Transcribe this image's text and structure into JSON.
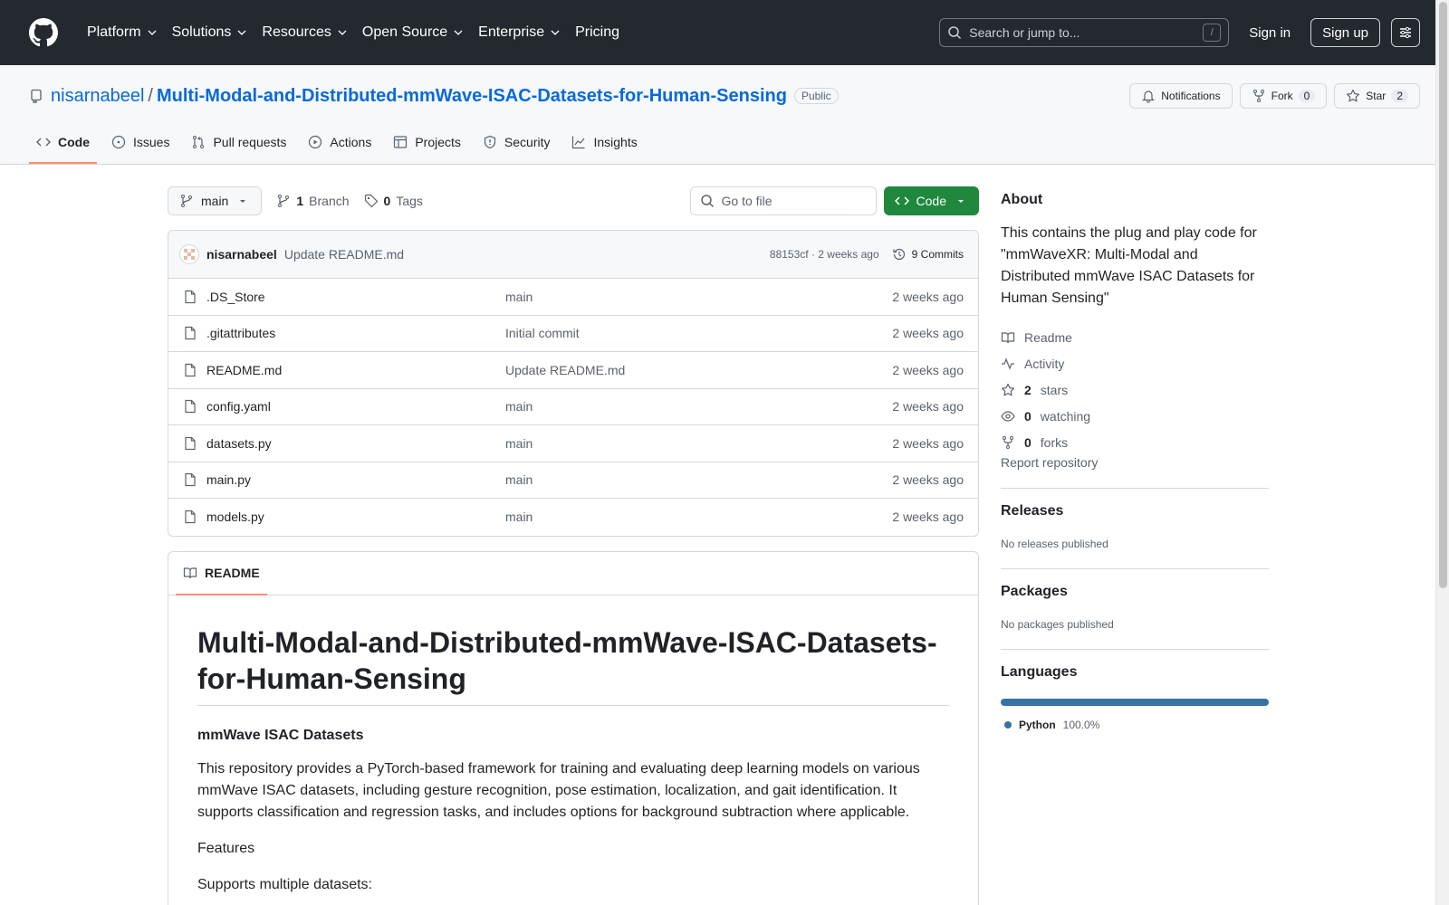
{
  "header": {
    "nav": [
      {
        "label": "Platform",
        "dropdown": true
      },
      {
        "label": "Solutions",
        "dropdown": true
      },
      {
        "label": "Resources",
        "dropdown": true
      },
      {
        "label": "Open Source",
        "dropdown": true
      },
      {
        "label": "Enterprise",
        "dropdown": true
      },
      {
        "label": "Pricing",
        "dropdown": false
      }
    ],
    "search_placeholder": "Search or jump to...",
    "search_shortcut": "/",
    "sign_in": "Sign in",
    "sign_up": "Sign up"
  },
  "repo": {
    "owner": "nisarnabeel",
    "separator": "/",
    "name": "Multi-Modal-and-Distributed-mmWave-ISAC-Datasets-for-Human-Sensing",
    "visibility": "Public",
    "notifications_label": "Notifications",
    "fork_label": "Fork",
    "fork_count": "0",
    "star_label": "Star",
    "star_count": "2"
  },
  "tabs": [
    {
      "label": "Code",
      "icon": "code-icon",
      "active": true
    },
    {
      "label": "Issues",
      "icon": "issue-icon",
      "active": false
    },
    {
      "label": "Pull requests",
      "icon": "pull-request-icon",
      "active": false
    },
    {
      "label": "Actions",
      "icon": "play-icon",
      "active": false
    },
    {
      "label": "Projects",
      "icon": "table-icon",
      "active": false
    },
    {
      "label": "Security",
      "icon": "shield-icon",
      "active": false
    },
    {
      "label": "Insights",
      "icon": "graph-icon",
      "active": false
    }
  ],
  "toolbar": {
    "branch": "main",
    "branch_count": "1",
    "branch_label": "Branch",
    "tag_count": "0",
    "tag_label": "Tags",
    "goto_placeholder": "Go to file",
    "code_button": "Code"
  },
  "commit": {
    "author": "nisarnabeel",
    "message": "Update README.md",
    "hash_time": "88153cf · 2 weeks ago",
    "commits_label": "9 Commits"
  },
  "files": [
    {
      "name": ".DS_Store",
      "message": "main",
      "date": "2 weeks ago"
    },
    {
      "name": ".gitattributes",
      "message": "Initial commit",
      "date": "2 weeks ago"
    },
    {
      "name": "README.md",
      "message": "Update README.md",
      "date": "2 weeks ago"
    },
    {
      "name": "config.yaml",
      "message": "main",
      "date": "2 weeks ago"
    },
    {
      "name": "datasets.py",
      "message": "main",
      "date": "2 weeks ago"
    },
    {
      "name": "main.py",
      "message": "main",
      "date": "2 weeks ago"
    },
    {
      "name": "models.py",
      "message": "main",
      "date": "2 weeks ago"
    }
  ],
  "readme": {
    "tab_label": "README",
    "title": "Multi-Modal-and-Distributed-mmWave-ISAC-Datasets-for-Human-Sensing",
    "subtitle": "mmWave ISAC Datasets",
    "intro": "This repository provides a PyTorch-based framework for training and evaluating deep learning models on various mmWave ISAC datasets, including gesture recognition, pose estimation, localization, and gait identification. It supports classification and regression tasks, and includes options for background subtraction where applicable.",
    "features": "Features",
    "supports": "Supports multiple datasets:"
  },
  "sidebar": {
    "about_title": "About",
    "about_desc": "This contains the plug and play code for \"mmWaveXR: Multi-Modal and Distributed mmWave ISAC Datasets for Human Sensing\"",
    "readme_link": "Readme",
    "activity_link": "Activity",
    "stars_count": "2",
    "stars_label": "stars",
    "watching_count": "0",
    "watching_label": "watching",
    "forks_count": "0",
    "forks_label": "forks",
    "report": "Report repository",
    "releases_title": "Releases",
    "releases_empty": "No releases published",
    "packages_title": "Packages",
    "packages_empty": "No packages published",
    "languages_title": "Languages",
    "language_name": "Python",
    "language_pct": "100.0%",
    "language_color": "#3572a5"
  },
  "colors": {
    "header_bg": "#24292f",
    "link_blue": "#0969da",
    "code_green": "#1f883d",
    "active_tab_underline": "#fd8c73"
  }
}
